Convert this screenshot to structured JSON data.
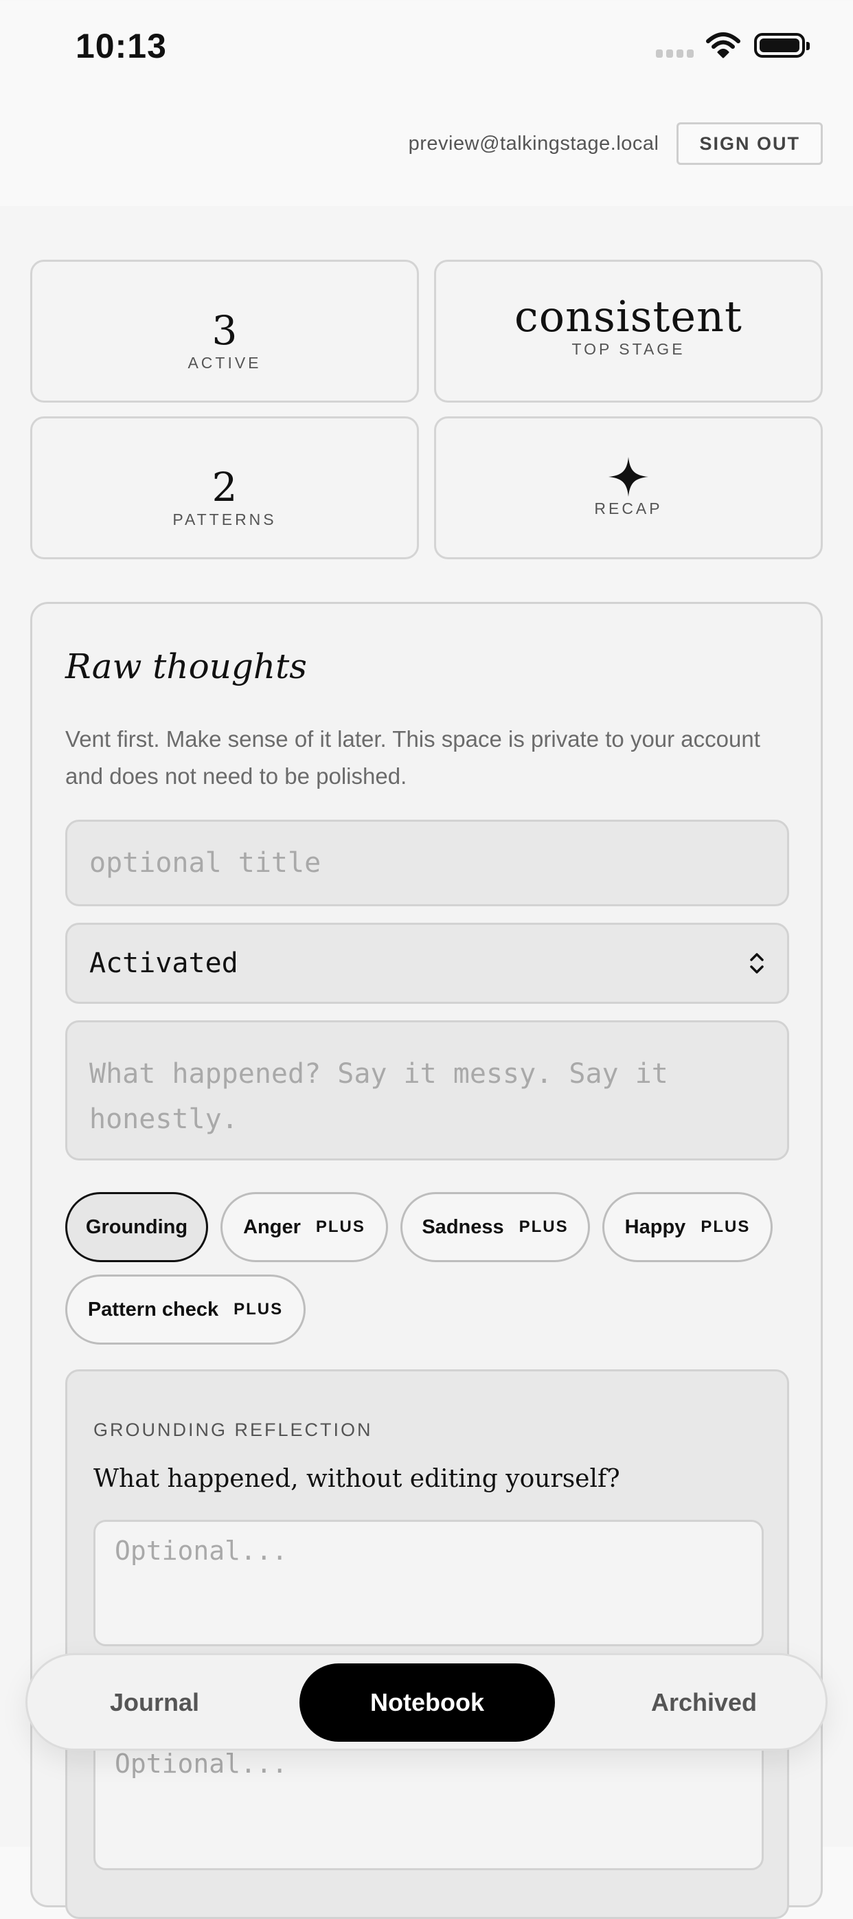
{
  "status_bar": {
    "time": "10:13"
  },
  "account": {
    "email": "preview@talkingstage.local",
    "sign_out_label": "SIGN OUT"
  },
  "stats": [
    {
      "value": "3",
      "label": "ACTIVE"
    },
    {
      "value": "consistent",
      "label": "TOP STAGE"
    },
    {
      "value": "2",
      "label": "PATTERNS"
    },
    {
      "icon": "sparkle-icon",
      "label": "RECAP"
    }
  ],
  "raw_thoughts": {
    "heading": "Raw thoughts",
    "description": "Vent first. Make sense of it later. This space is private to your account and does not need to be polished.",
    "title_placeholder": "optional title",
    "mood_selected": "Activated",
    "body_placeholder": "What happened? Say it messy. Say it honestly."
  },
  "chips": [
    {
      "label": "Grounding",
      "badge": "",
      "active": true
    },
    {
      "label": "Anger",
      "badge": "PLUS",
      "active": false
    },
    {
      "label": "Sadness",
      "badge": "PLUS",
      "active": false
    },
    {
      "label": "Happy",
      "badge": "PLUS",
      "active": false
    },
    {
      "label": "Pattern check",
      "badge": "PLUS",
      "active": false
    }
  ],
  "reflection": {
    "label": "GROUNDING REFLECTION",
    "question": "What happened, without editing yourself?",
    "answer_placeholder": "Optional...",
    "second_placeholder": "Optional..."
  },
  "tabs": [
    {
      "label": "Journal",
      "active": false
    },
    {
      "label": "Notebook",
      "active": true
    },
    {
      "label": "Archived",
      "active": false
    }
  ]
}
